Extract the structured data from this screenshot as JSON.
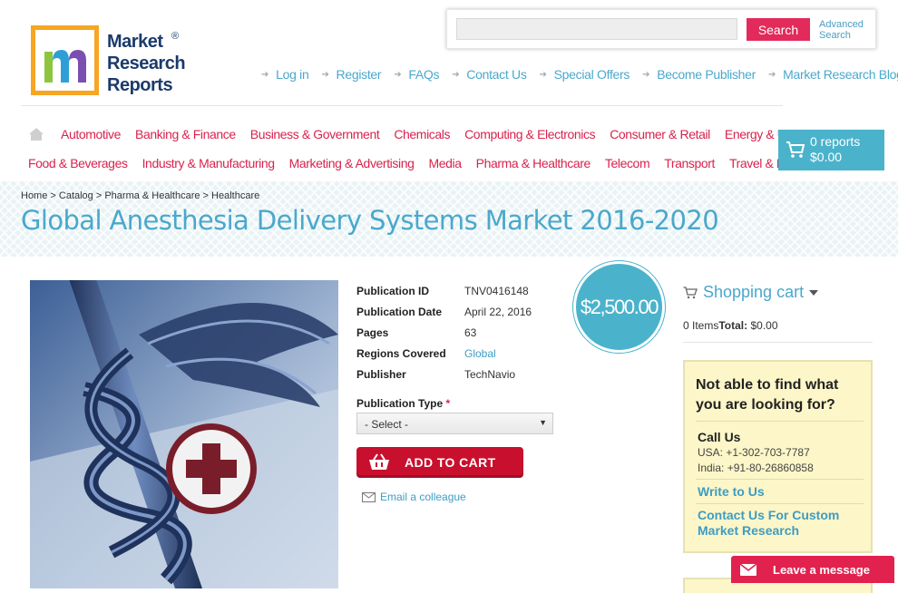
{
  "logo": {
    "letter": "m",
    "line1": "Market",
    "line2": "Research",
    "line3": "Reports",
    "reg": "®"
  },
  "search": {
    "placeholder": "",
    "button_label": "Search",
    "advanced_label": "Advanced Search"
  },
  "top_links": [
    "Log in",
    "Register",
    "FAQs",
    "Contact Us",
    "Special Offers",
    "Become Publisher",
    "Market Research Blog"
  ],
  "categories_row1": [
    "Automotive",
    "Banking & Finance",
    "Business & Government",
    "Chemicals",
    "Computing & Electronics",
    "Consumer & Retail",
    "Energy & Utilities"
  ],
  "categories_row2": [
    "Food & Beverages",
    "Industry & Manufacturing",
    "Marketing & Advertising",
    "Media",
    "Pharma & Healthcare",
    "Telecom",
    "Transport",
    "Travel & Leisure"
  ],
  "cart": {
    "count": "0 reports",
    "total": "$0.00"
  },
  "breadcrumb": "Home > Catalog > Pharma & Healthcare > Healthcare",
  "page_title": "Global Anesthesia Delivery Systems Market 2016-2020",
  "details": {
    "id_label": "Publication ID",
    "id_value": "TNV0416148",
    "date_label": "Publication Date",
    "date_value": "April 22, 2016",
    "pages_label": "Pages",
    "pages_value": "63",
    "regions_label": "Regions Covered",
    "regions_value": "Global",
    "publisher_label": "Publisher",
    "publisher_value": "TechNavio"
  },
  "price": "$2,500.00",
  "pub_type": {
    "label": "Publication Type",
    "required": "*",
    "selected": "- Select -"
  },
  "add_to_cart_label": "ADD TO CART",
  "email_colleague_label": "Email a colleague",
  "sidebar": {
    "cart_title": "Shopping cart",
    "items_text": "0 Items",
    "total_label": "Total:",
    "total_value": "$0.00",
    "help_question": "Not able to find what you are looking for?",
    "call_title": "Call Us",
    "phone_usa": "USA: +1-302-703-7787",
    "phone_india": "India: +91-80-26860858",
    "write_label": "Write to Us",
    "custom_label": "Contact Us For Custom Market Research"
  },
  "leave_message_label": "Leave a message",
  "colors": {
    "brand_pink": "#e22b5b",
    "accent_blue": "#4ab3cb",
    "link_blue": "#4aa8cc",
    "category_red": "#d8234c",
    "add_cart_red": "#c8102e",
    "help_yellow": "#fcf6c8"
  }
}
